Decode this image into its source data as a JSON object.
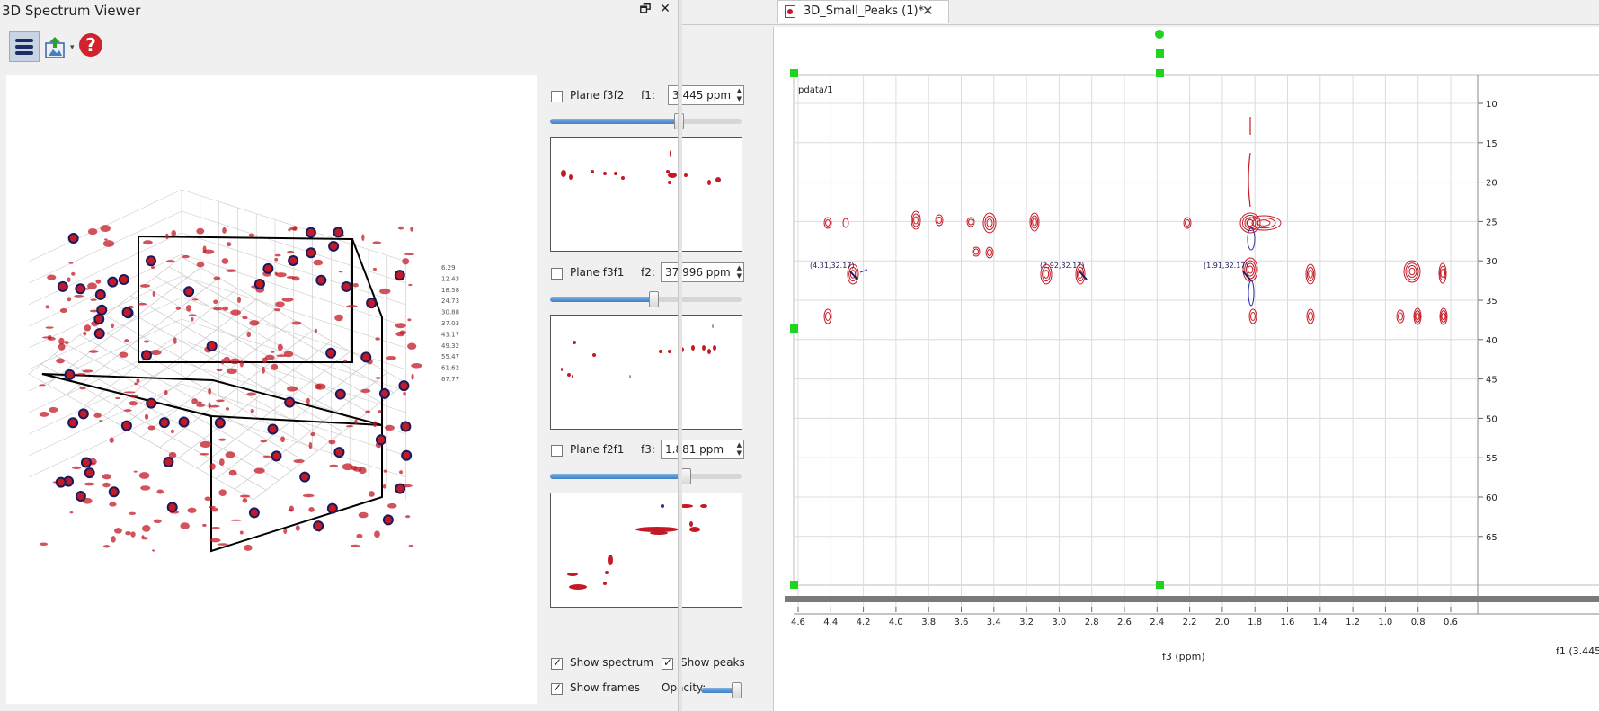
{
  "left_panel": {
    "title": "3D Spectrum Viewer",
    "window_buttons": {
      "restore": "🗗",
      "close": "✕"
    },
    "toolbar": {
      "help_glyph": "?",
      "export_arrow": "▾"
    },
    "planes": [
      {
        "label": "Plane f3f2",
        "axis": "f1:",
        "value": "3.445 ppm",
        "checked": false,
        "slider": 0.67
      },
      {
        "label": "Plane f3f1",
        "axis": "f2:",
        "value": "37.996 ppm",
        "checked": false,
        "slider": 0.55
      },
      {
        "label": "Plane f2f1",
        "axis": "f3:",
        "value": "1.881 ppm",
        "checked": false,
        "slider": 0.71
      }
    ],
    "options": {
      "show_spectrum": {
        "label": "Show spectrum",
        "checked": true
      },
      "show_peaks": {
        "label": "Show peaks",
        "checked": true
      },
      "show_frames": {
        "label": "Show frames",
        "checked": true
      },
      "opacity": {
        "label": "Opacity:",
        "value": 0.9
      }
    },
    "axis3d_z_ticks": [
      "6.29",
      "12.43",
      "18.58",
      "24.73",
      "30.88",
      "37.03",
      "43.17",
      "49.32",
      "55.47",
      "61.62",
      "67.77"
    ]
  },
  "document": {
    "tab_label": "3D_Small_Peaks (1)*",
    "tab_close": "✕",
    "plot_label": "pdata/1",
    "x_axis_title": "f3 (ppm)",
    "y_axis_corner": "f1 (3.445",
    "x_ticks": [
      "4.6",
      "4.4",
      "4.2",
      "4.0",
      "3.8",
      "3.6",
      "3.4",
      "3.2",
      "3.0",
      "2.8",
      "2.6",
      "2.4",
      "2.2",
      "2.0",
      "1.8",
      "1.6",
      "1.4",
      "1.2",
      "1.0",
      "0.8",
      "0.6"
    ],
    "y_ticks": [
      "10",
      "15",
      "20",
      "25",
      "30",
      "35",
      "40",
      "45",
      "50",
      "55",
      "60",
      "65"
    ],
    "peak_labels": [
      "(4.31,32.17)",
      "(2.92,32.17)",
      "(1.91,32.17)"
    ]
  },
  "colors": {
    "spectrum_red": "#c41a25",
    "spectrum_blue": "#2a2aa8",
    "handle_green": "#21d321",
    "peak_dark": "#1a1a5e"
  }
}
